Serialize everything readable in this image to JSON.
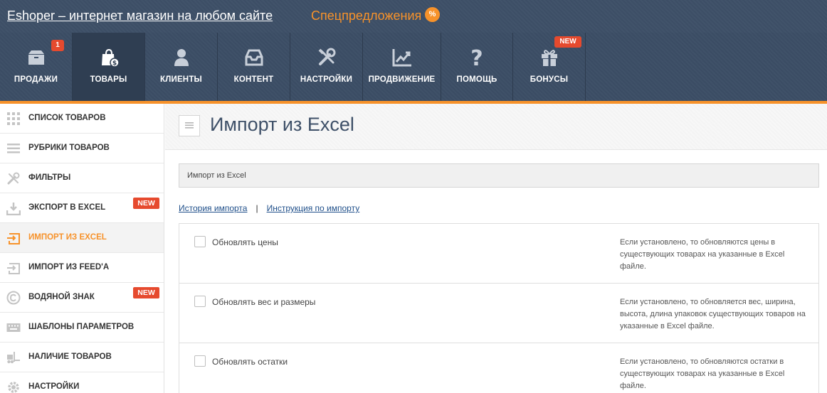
{
  "topbar": {
    "brand": "Eshoper – интернет магазин на любом сайте",
    "specials": "Спецпредложения",
    "specials_badge": "%"
  },
  "nav": {
    "items": [
      {
        "label": "ПРОДАЖИ",
        "icon": "box-icon",
        "badge": "1"
      },
      {
        "label": "ТОВАРЫ",
        "icon": "shopping-bag-icon",
        "active": true
      },
      {
        "label": "КЛИЕНТЫ",
        "icon": "user-icon"
      },
      {
        "label": "КОНТЕНТ",
        "icon": "inbox-icon"
      },
      {
        "label": "НАСТРОЙКИ",
        "icon": "tools-icon"
      },
      {
        "label": "ПРОДВИЖЕНИЕ",
        "icon": "chart-icon"
      },
      {
        "label": "ПОМОЩЬ",
        "icon": "question-icon"
      },
      {
        "label": "БОНУСЫ",
        "icon": "gift-icon",
        "badge": "NEW"
      }
    ]
  },
  "sidebar": {
    "items": [
      {
        "label": "СПИСОК ТОВАРОВ",
        "icon": "grid-icon"
      },
      {
        "label": "РУБРИКИ ТОВАРОВ",
        "icon": "list-icon"
      },
      {
        "label": "ФИЛЬТРЫ",
        "icon": "tools-icon"
      },
      {
        "label": "ЭКСПОРТ В EXCEL",
        "icon": "download-icon",
        "badge": "NEW"
      },
      {
        "label": "ИМПОРТ ИЗ EXCEL",
        "icon": "import-icon",
        "active": true
      },
      {
        "label": "ИМПОРТ ИЗ FEED'A",
        "icon": "import-feed-icon"
      },
      {
        "label": "ВОДЯНОЙ ЗНАК",
        "icon": "copyright-icon",
        "badge": "NEW"
      },
      {
        "label": "ШАБЛОНЫ ПАРАМЕТРОВ",
        "icon": "keyboard-icon"
      },
      {
        "label": "НАЛИЧИЕ ТОВАРОВ",
        "icon": "forklift-icon"
      },
      {
        "label": "НАСТРОЙКИ",
        "icon": "gear-icon"
      }
    ]
  },
  "page": {
    "title": "Импорт из Excel",
    "breadcrumb": "Импорт из Excel",
    "link_history": "История импорта",
    "link_separator": "|",
    "link_instructions": "Инструкция по импорту"
  },
  "options": [
    {
      "label": "Обновлять цены",
      "checked": false,
      "description": "Если установлено, то обновляются цены в существующих товарах на указанные в Excel файле."
    },
    {
      "label": "Обновлять вес и размеры",
      "checked": false,
      "description": "Если установлено, то обновляется вес, ширина, высота, длина упаковок существующих товаров на указанные в Excel файле."
    },
    {
      "label": "Обновлять остатки",
      "checked": false,
      "description": "Если установлено, то обновляются остатки в существующих товарах на указанные в Excel файле."
    }
  ],
  "colors": {
    "header_bg": "#3e5068",
    "accent": "#f7922a",
    "badge_red": "#e64a2e",
    "link": "#1f4f8a"
  }
}
